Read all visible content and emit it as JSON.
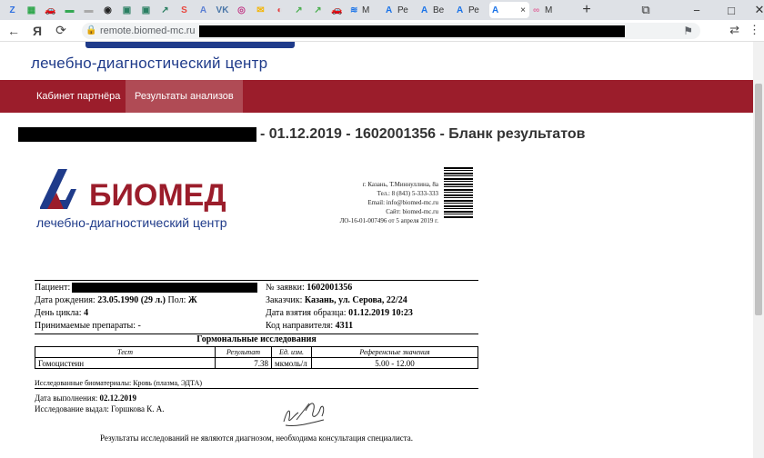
{
  "browser": {
    "tabs_compact": [
      {
        "icon": "Z",
        "color": "#2d6fe0"
      },
      {
        "icon": "▦",
        "color": "#2ea64b"
      },
      {
        "icon": "🚗",
        "color": "#dd3333"
      },
      {
        "icon": "▬",
        "color": "#34a853"
      },
      {
        "icon": "▬",
        "color": "#aaaaaa"
      },
      {
        "icon": "◉",
        "color": "#222222"
      },
      {
        "icon": "▣",
        "color": "#2a7f62"
      },
      {
        "icon": "▣",
        "color": "#2a7f62"
      },
      {
        "icon": "↗",
        "color": "#2a7f62"
      },
      {
        "icon": "S",
        "color": "#e8453c"
      },
      {
        "icon": "A",
        "color": "#5b7fd4"
      },
      {
        "icon": "VK",
        "color": "#4a76a8"
      },
      {
        "icon": "◎",
        "color": "#c13584"
      },
      {
        "icon": "✉",
        "color": "#f4b400"
      },
      {
        "icon": "◐",
        "color": "#e34242"
      },
      {
        "icon": "↗",
        "color": "#4caf50"
      },
      {
        "icon": "↗",
        "color": "#4caf50"
      },
      {
        "icon": "🚗",
        "color": "#dd3333"
      }
    ],
    "tabs_wide": [
      {
        "label": "М",
        "icon": "≋"
      },
      {
        "label": "Ре",
        "icon": "A"
      },
      {
        "label": "Ве",
        "icon": "A"
      },
      {
        "label": "Ре",
        "icon": "A"
      }
    ],
    "active_tab": {
      "label": "×",
      "icon": "A"
    },
    "trailing_tab": {
      "label": "М",
      "icon": "∞"
    },
    "new_tab_label": "+",
    "url": "remote.biomed-mc.ru",
    "window_controls": {
      "minimize": "−",
      "maximize": "□",
      "close": "✕"
    }
  },
  "site": {
    "tagline": "лечебно-диагностический центр",
    "nav": [
      {
        "label": "Кабинет партнёра"
      },
      {
        "label": "Результаты анализов"
      }
    ]
  },
  "doc_title_suffix": "- 01.12.2019 - 1602001356 - Бланк результатов",
  "form": {
    "brand_name": "БИОМЕД",
    "brand_tagline": "лечебно-диагностический центр",
    "address_lines": [
      "г. Казань, Т.Миннуллина, 8а",
      "Тел.: 8 (843) 5-333-333",
      "Email: info@biomed-mc.ru",
      "Сайт: biomed-mc.ru",
      "ЛО-16-01-007496 от 5 апреля 2019 г."
    ],
    "patient_label": "Пациент:",
    "order_label": "№ заявки:",
    "order_value": "1602001356",
    "dob_label": "Дата рождения:",
    "dob_value": "23.05.1990 (29 л.)",
    "sex_label": "Пол:",
    "sex_value": "Ж",
    "customer_label": "Заказчик:",
    "customer_value": "Казань, ул. Серова, 22/24",
    "cycle_label": "День цикла:",
    "cycle_value": "4",
    "sample_date_label": "Дата взятия образца:",
    "sample_date_value": "01.12.2019 10:23",
    "meds_label": "Принимаемые препараты: -",
    "referral_label": "Код направителя:",
    "referral_value": "4311",
    "section_title": "Гормональные исследования",
    "table_headers": [
      "Тест",
      "Результат",
      "Ед. изм.",
      "Референсные значения"
    ],
    "table_rows": [
      [
        "Гомоцистеин",
        "7.38",
        "мкмоль/л",
        "5.00 - 12.00"
      ]
    ],
    "biomaterial": "Исследованные биоматериалы: Кровь (плазма, ЭДТА)",
    "completed_label": "Дата выполнения:",
    "completed_value": "02.12.2019",
    "issued_by": "Исследование выдал: Горшкова К. А.",
    "disclaimer": "Результаты исследований не являются диагнозом, необходима консультация специалиста."
  }
}
